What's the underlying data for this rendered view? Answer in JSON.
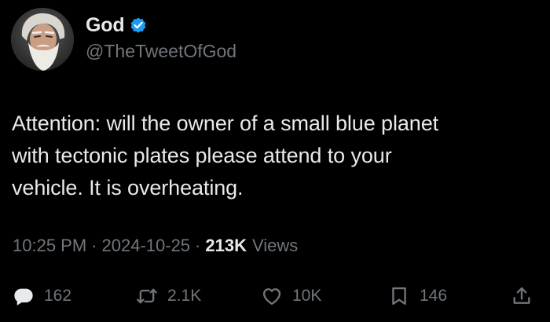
{
  "author": {
    "display_name": "God",
    "handle": "@TheTweetOfGod",
    "verified": true,
    "avatar_icon": "bearded-man-portrait"
  },
  "tweet": {
    "text": "Attention: will the owner of a small blue planet\nwith tectonic plates please attend to your\nvehicle. It is overheating.",
    "time": "10:25 PM",
    "separator": "·",
    "date": "2024-10-25",
    "views_count": "213K",
    "views_label": "Views"
  },
  "actions": {
    "reply": {
      "icon": "reply-icon",
      "count": "162"
    },
    "retweet": {
      "icon": "retweet-icon",
      "count": "2.1K"
    },
    "like": {
      "icon": "heart-icon",
      "count": "10K"
    },
    "bookmark": {
      "icon": "bookmark-icon",
      "count": "146"
    },
    "share": {
      "icon": "share-icon"
    }
  },
  "colors": {
    "background": "#000000",
    "primary_text": "#e7e9ea",
    "secondary_text": "#71767b",
    "verified_blue": "#1d9bf0"
  }
}
